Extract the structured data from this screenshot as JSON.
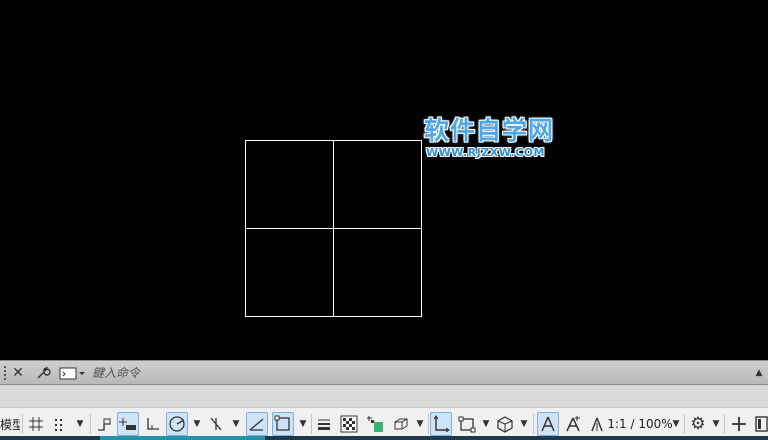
{
  "watermark": {
    "title": "软件自学网",
    "url": "WWW.RJZXW.COM"
  },
  "command_line": {
    "placeholder": "鍵入命令",
    "icons": [
      "grip-handle-icon",
      "close-icon",
      "wrench-icon",
      "command-prompt-icon",
      "chevron-up-icon"
    ]
  },
  "status_bar": {
    "model_tab": "模型",
    "annotation_scale": "1:1 / 100%",
    "icons": [
      "grid-icon",
      "snap-mode-icon",
      "infer-constraints-icon",
      "dynamic-input-icon",
      "ortho-mode-icon",
      "polar-tracking-icon",
      "isometric-drafting-icon",
      "object-snap-tracking-icon",
      "object-snap-icon",
      "lineweight-icon",
      "transparency-icon",
      "selection-cycling-icon",
      "3d-object-snap-icon",
      "dynamic-ucs-icon",
      "selection-filtering-icon",
      "gizmo-icon",
      "annotation-visibility-icon",
      "auto-scale-icon",
      "annotation-scale-icon",
      "workspace-gear-icon",
      "plus-icon",
      "customization-icon"
    ]
  },
  "colors": {
    "canvas": "#000000",
    "lines": "#ffffff",
    "watermark": "#4aa8f0",
    "active_toggle": "#cfe3f7"
  }
}
